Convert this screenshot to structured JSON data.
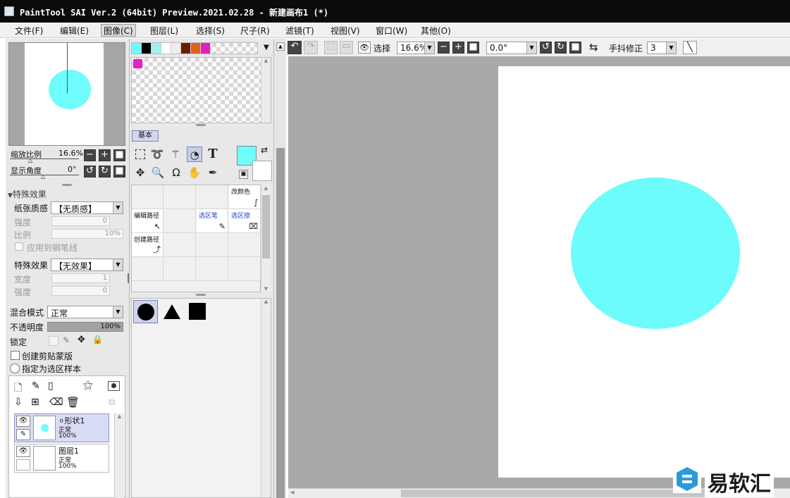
{
  "title": "PaintTool SAI Ver.2 (64bit) Preview.2021.02.28 - 新建画布1 (*)",
  "menu": [
    "文件(F)",
    "编辑(E)",
    "图像(C)",
    "图层(L)",
    "选择(S)",
    "尺子(R)",
    "滤镜(T)",
    "视图(V)",
    "窗口(W)",
    "其他(O)"
  ],
  "active_menu_index": 2,
  "navigator": {
    "zoom_label": "缩放比例",
    "zoom_value": "16.6%",
    "angle_label": "显示角度",
    "angle_value": "0°"
  },
  "effects": {
    "header": "特殊效果",
    "paper_label": "纸张质感",
    "paper_value": "【无质感】",
    "strength_label": "强度",
    "strength_value": "0",
    "scale_label": "比例",
    "scale_value": "10%",
    "apply_to_lines": "应用到钢笔线",
    "effect_label": "特殊效果",
    "effect_value": "【无效果】",
    "width_label": "宽度",
    "width_value": "1",
    "strength2_label": "强度",
    "strength2_value": "0"
  },
  "layer_props": {
    "blend_label": "混合模式",
    "blend_value": "正常",
    "opacity_label": "不透明度",
    "opacity_value": "100%",
    "lock_label": "锁定",
    "clip_label": "创建剪贴蒙版",
    "sample_label": "指定为选区样本"
  },
  "layers": [
    {
      "name": "形状1",
      "mode": "正常",
      "opacity": "100%",
      "selected": true,
      "has_circle": true
    },
    {
      "name": "图层1",
      "mode": "正常",
      "opacity": "100%",
      "selected": false,
      "has_circle": false
    }
  ],
  "swatches": [
    "#6ff8f8",
    "#000000",
    "#9ff0f0",
    "#ffffff",
    "#eeeeee",
    "#6b1f00",
    "#e06020",
    "#e020b8"
  ],
  "custom_swatch": "#e020c8",
  "tool_tab": "基本",
  "main_color": "#6ffcfc",
  "tool_cells": [
    {
      "label": "改颜色",
      "icon": "curve-icon",
      "col": 3,
      "row": 0
    },
    {
      "label": "编辑路径",
      "icon": "arrow-icon",
      "col": 0,
      "row": 1
    },
    {
      "label": "选区笔",
      "icon": "pen-icon",
      "col": 2,
      "row": 1,
      "blue": true
    },
    {
      "label": "选区擦",
      "icon": "eraser-icon",
      "col": 3,
      "row": 1,
      "blue": true
    },
    {
      "label": "创建路径",
      "icon": "path-icon",
      "col": 0,
      "row": 2
    }
  ],
  "shapes": [
    "circle",
    "triangle",
    "square"
  ],
  "toolbar": {
    "select_label": "选择",
    "zoom_value": "16.6%",
    "angle_value": "0.0°",
    "stabilizer_label": "手抖修正",
    "stabilizer_value": "3"
  },
  "canvas": {
    "bg_color": "#a9a9a9",
    "paper_color": "#ffffff",
    "ellipse_color": "#6cfcfc"
  },
  "watermark": "易软汇"
}
